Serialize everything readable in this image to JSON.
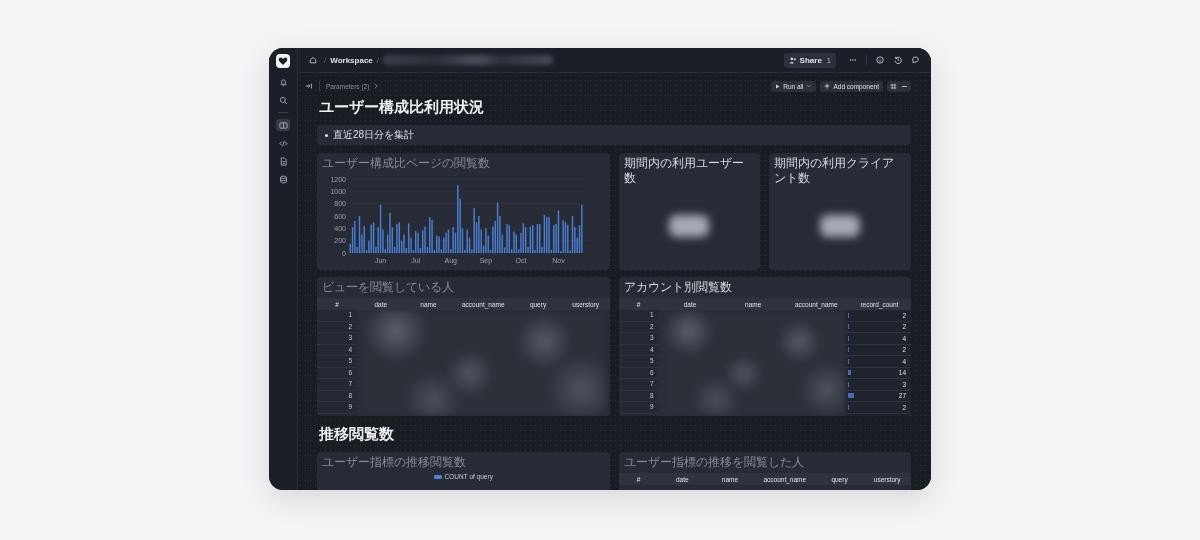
{
  "sidebar": {
    "items": [
      {
        "selected": false
      },
      {
        "selected": false
      },
      {
        "selected": true
      },
      {
        "selected": false
      },
      {
        "selected": false
      },
      {
        "selected": false
      }
    ]
  },
  "topbar": {
    "breadcrumb": [
      "Workspace"
    ],
    "separator": "/",
    "share": {
      "label": "Share",
      "count": "1"
    }
  },
  "toolbar": {
    "parameters": "Parameters (2)",
    "run_all": "Run all",
    "add_component": "Add component"
  },
  "title": "ユーザー構成比利用状況",
  "note": {
    "bullets": [
      "直近28日分を集計"
    ]
  },
  "views_chart": {
    "title": "ユーザー構成比ページの閲覧数",
    "chart_data": {
      "type": "bar",
      "grid": true,
      "ylim": [
        0,
        1200
      ],
      "yticks": [
        0,
        200,
        400,
        600,
        800,
        1000,
        1200
      ],
      "categories": [
        null,
        null,
        null,
        null,
        null,
        null,
        null,
        null,
        null,
        null,
        null,
        null,
        null,
        "Jun",
        null,
        null,
        null,
        null,
        null,
        null,
        null,
        null,
        null,
        null,
        null,
        null,
        null,
        null,
        "Jul",
        null,
        null,
        null,
        null,
        null,
        null,
        null,
        null,
        null,
        null,
        null,
        null,
        null,
        null,
        "Aug",
        null,
        null,
        null,
        null,
        null,
        null,
        null,
        null,
        null,
        null,
        null,
        null,
        null,
        null,
        "Sep",
        null,
        null,
        null,
        null,
        null,
        null,
        null,
        null,
        null,
        null,
        null,
        null,
        null,
        null,
        "Oct",
        null,
        null,
        null,
        null,
        null,
        null,
        null,
        null,
        null,
        null,
        null,
        null,
        null,
        null,
        null,
        "Nov",
        null,
        null,
        null,
        null,
        null,
        null,
        null,
        null,
        null,
        null
      ],
      "values": [
        150,
        420,
        520,
        100,
        600,
        300,
        440,
        50,
        200,
        460,
        500,
        100,
        420,
        780,
        380,
        60,
        300,
        650,
        420,
        100,
        470,
        500,
        200,
        300,
        80,
        480,
        250,
        50,
        360,
        330,
        80,
        370,
        430,
        100,
        580,
        540,
        50,
        280,
        270,
        60,
        250,
        330,
        380,
        60,
        420,
        330,
        1100,
        880,
        400,
        50,
        380,
        250,
        60,
        730,
        500,
        600,
        380,
        120,
        400,
        280,
        50,
        430,
        520,
        820,
        600,
        300,
        90,
        470,
        450,
        60,
        350,
        300,
        60,
        330,
        480,
        420,
        100,
        430,
        450,
        50,
        470,
        470,
        100,
        620,
        580,
        580,
        50,
        450,
        470,
        690,
        30,
        530,
        500,
        450,
        40,
        600,
        420,
        250,
        450,
        780
      ]
    }
  },
  "metrics": [
    {
      "title": "期間内の利用ユーザー数"
    },
    {
      "title": "期間内の利用クライアント数"
    }
  ],
  "viewer_table": {
    "title": "ビューを閲覧している人",
    "columns": [
      "#",
      "date",
      "name",
      "account_name",
      "query",
      "userstory"
    ],
    "row_numbers": [
      "1",
      "2",
      "3",
      "4",
      "5",
      "6",
      "7",
      "8",
      "9"
    ]
  },
  "account_table": {
    "title": "アカウント別閲覧数",
    "columns": [
      "#",
      "date",
      "name",
      "account_name",
      "record_count"
    ],
    "rows": [
      {
        "n": "1",
        "record_count": "2"
      },
      {
        "n": "2",
        "record_count": "2"
      },
      {
        "n": "3",
        "record_count": "4"
      },
      {
        "n": "4",
        "record_count": "2"
      },
      {
        "n": "5",
        "record_count": "4"
      },
      {
        "n": "6",
        "record_count": "14"
      },
      {
        "n": "7",
        "record_count": "3"
      },
      {
        "n": "8",
        "record_count": "27"
      },
      {
        "n": "9",
        "record_count": "2"
      }
    ]
  },
  "section_title": "推移閲覧数",
  "trend_chart": {
    "title": "ユーザー指標の推移閲覧数",
    "legend": [
      {
        "name": "COUNT of query",
        "color": "#4a7fd4"
      }
    ]
  },
  "trend_table": {
    "title": "ユーザー指標の推移を閲覧した人",
    "columns": [
      "#",
      "date",
      "name",
      "account_name",
      "query",
      "userstory"
    ]
  }
}
